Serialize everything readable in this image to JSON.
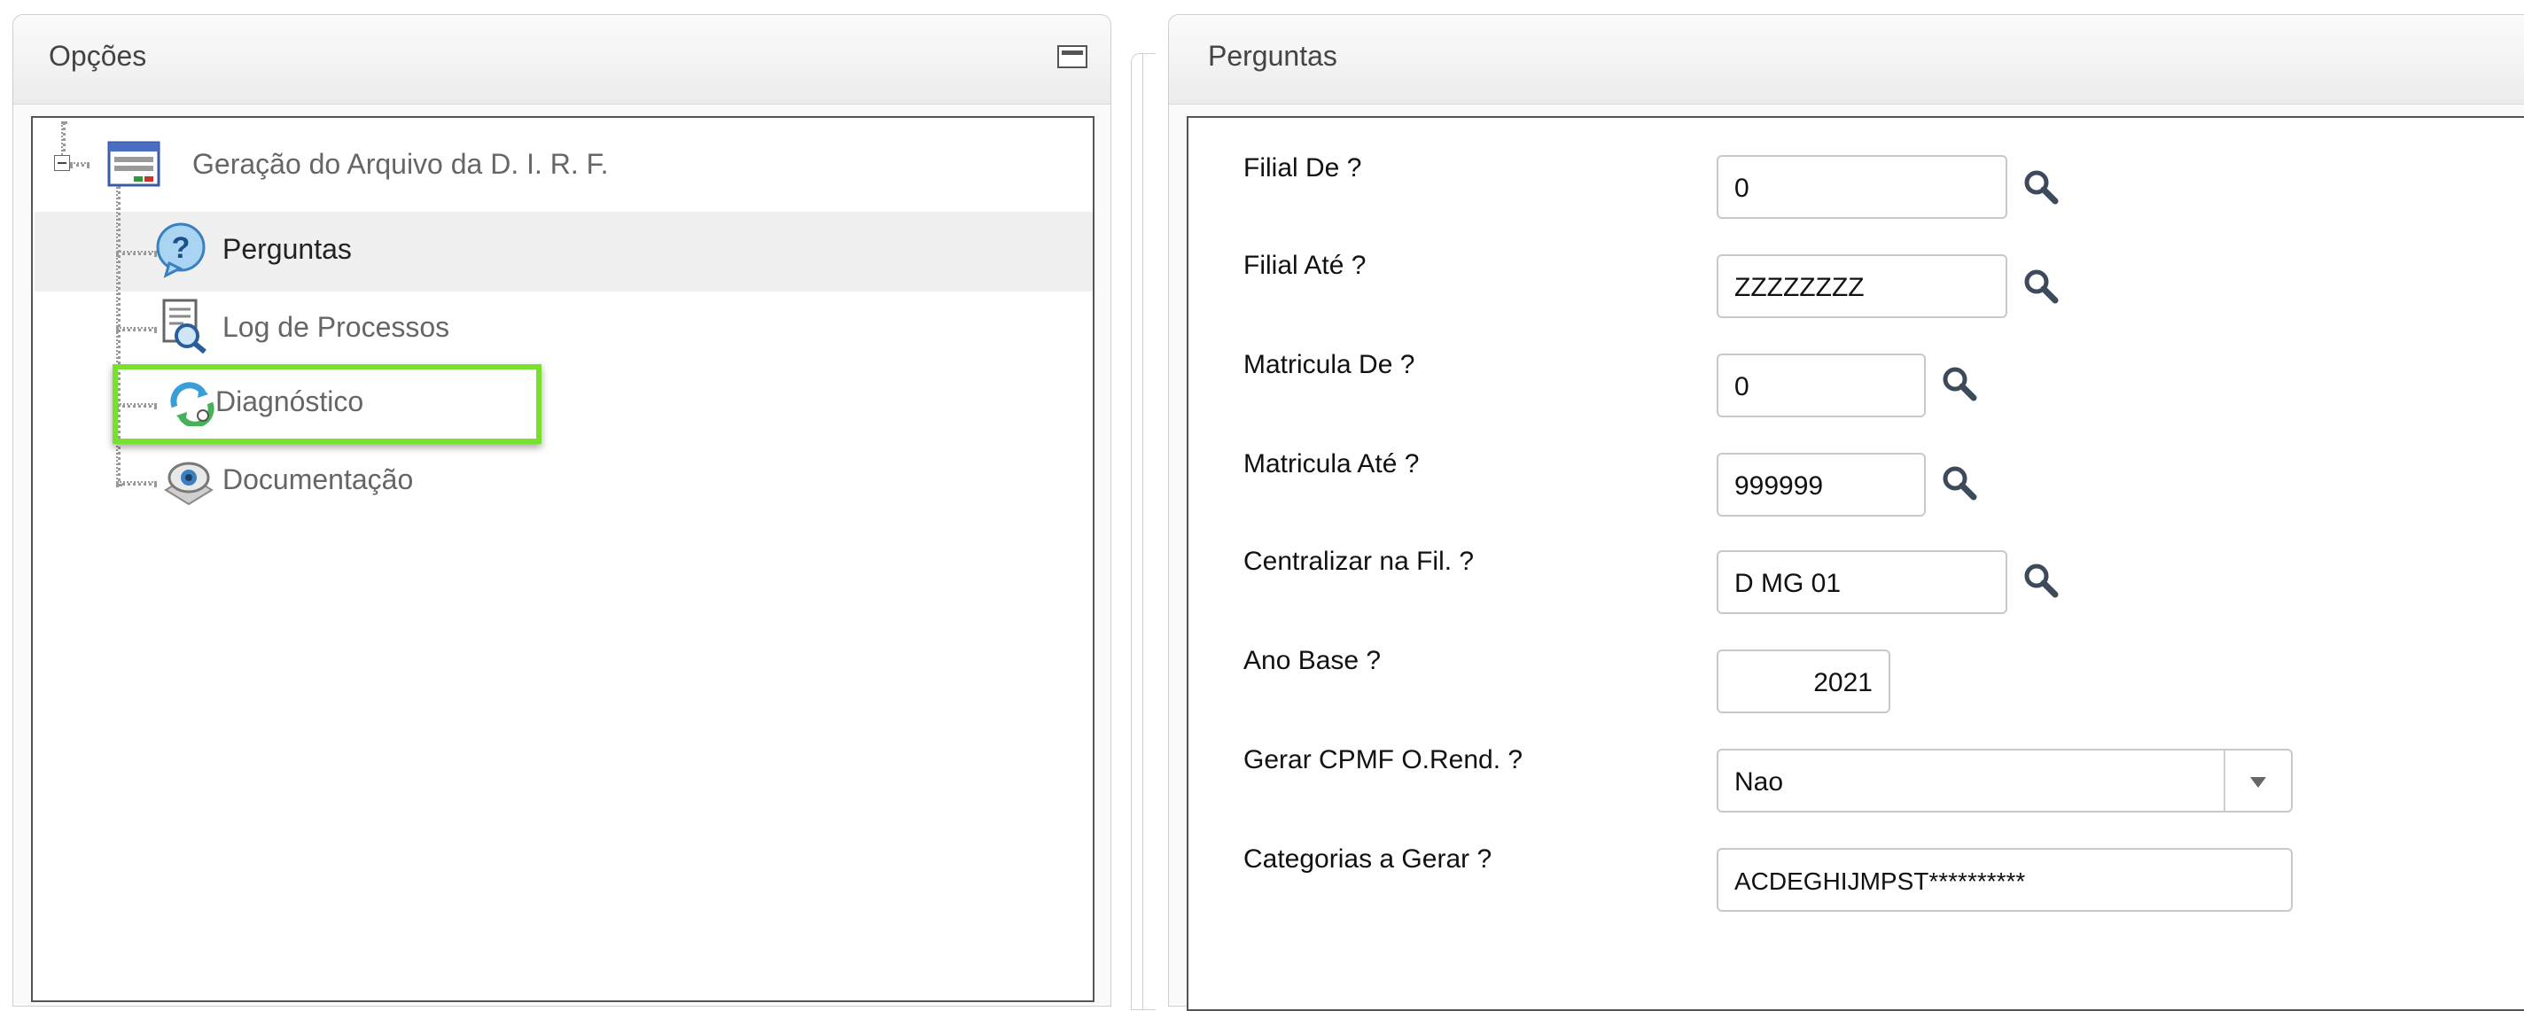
{
  "left_panel": {
    "title": "Opções",
    "tree": {
      "root_label": "Geração do Arquivo da D. I. R. F.",
      "items": [
        {
          "label": "Perguntas",
          "icon": "question-icon",
          "selected": true
        },
        {
          "label": "Log de Processos",
          "icon": "log-document-icon"
        },
        {
          "label": "Diagnóstico",
          "icon": "diagnostic-refresh-icon",
          "highlighted": true
        },
        {
          "label": "Documentação",
          "icon": "documentation-eye-icon"
        }
      ]
    }
  },
  "right_panel": {
    "title": "Perguntas",
    "questions": [
      {
        "label": "Filial De ?",
        "value": "0"
      },
      {
        "label": "Filial Até ?",
        "value": "ZZZZZZZZ"
      },
      {
        "label": "Matricula De ?",
        "value": "0"
      },
      {
        "label": "Matricula Até ?",
        "value": "999999"
      },
      {
        "label": "Centralizar na Fil. ?",
        "value": "D MG 01"
      },
      {
        "label": "Ano Base ?",
        "value": "2021"
      },
      {
        "label": "Gerar CPMF O.Rend. ?",
        "value": "Nao"
      },
      {
        "label": "Categorias a Gerar ?",
        "value": "ACDEGHIJMPST**********"
      }
    ]
  },
  "colors": {
    "highlight_border": "#78e12b",
    "selected_row": "#f0f0f0"
  }
}
